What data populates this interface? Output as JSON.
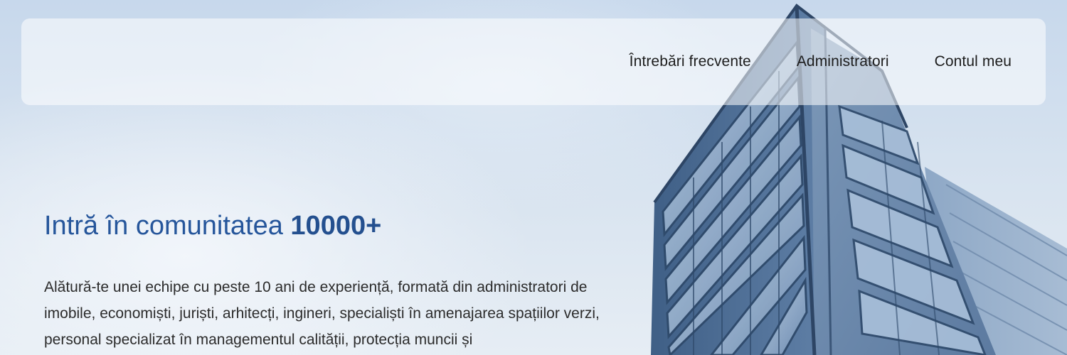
{
  "nav": {
    "items": [
      {
        "label": "Întrebări frecvente"
      },
      {
        "label": "Administratori"
      },
      {
        "label": "Contul meu"
      }
    ]
  },
  "hero": {
    "headline_prefix": "Intră în comunitatea ",
    "headline_number": "10000+",
    "intro_text": "Alătură-te unei echipe cu peste 10 ani de experiență, formată din administratori de imobile, economiști, juriști, arhitecți, ingineri, specialiști în amenajarea spațiilor verzi, personal specializat în managementul calității, protecția muncii și"
  },
  "colors": {
    "accent": "#26569b",
    "body_text": "#2b2b2b",
    "nav_text": "#1c1c1c"
  }
}
